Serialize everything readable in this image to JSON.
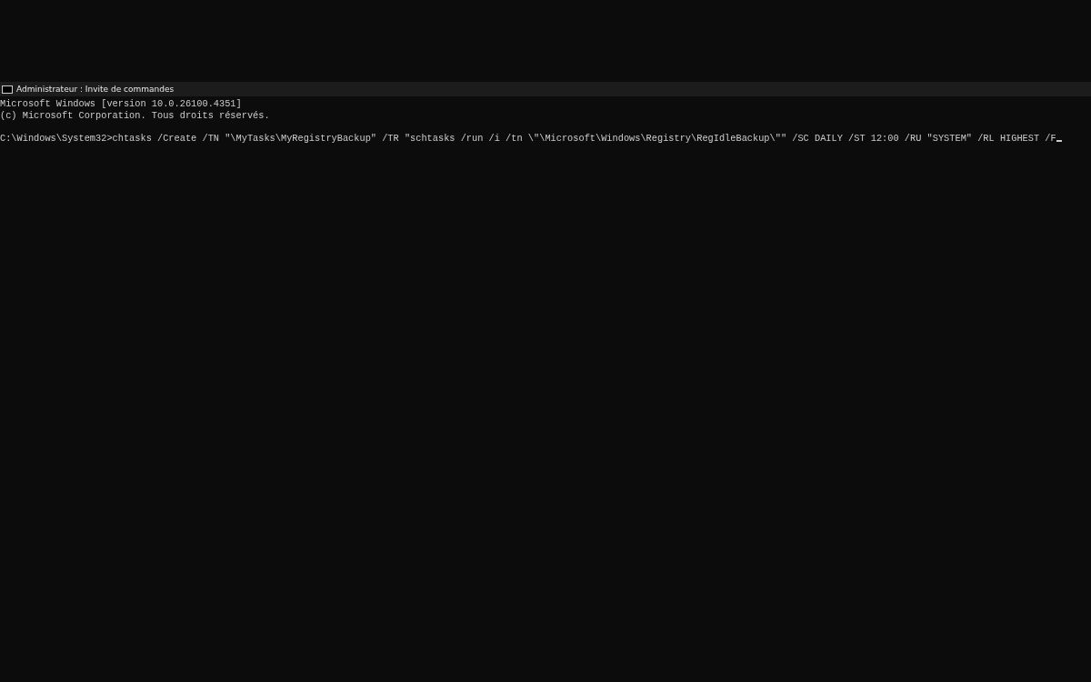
{
  "window": {
    "title": "Administrateur : Invite de commandes"
  },
  "console": {
    "output_lines": [
      "Microsoft Windows [version 10.0.26100.4351]",
      "(c) Microsoft Corporation. Tous droits réservés."
    ],
    "input_line": "C:\\Windows\\System32>chtasks /Create /TN \"\\MyTasks\\MyRegistryBackup\" /TR \"schtasks /run /i /tn \\\"\\Microsoft\\Windows\\Registry\\RegIdleBackup\\\"\" /SC DAILY /ST 12:00 /RU \"SYSTEM\" /RL HIGHEST /F"
  }
}
